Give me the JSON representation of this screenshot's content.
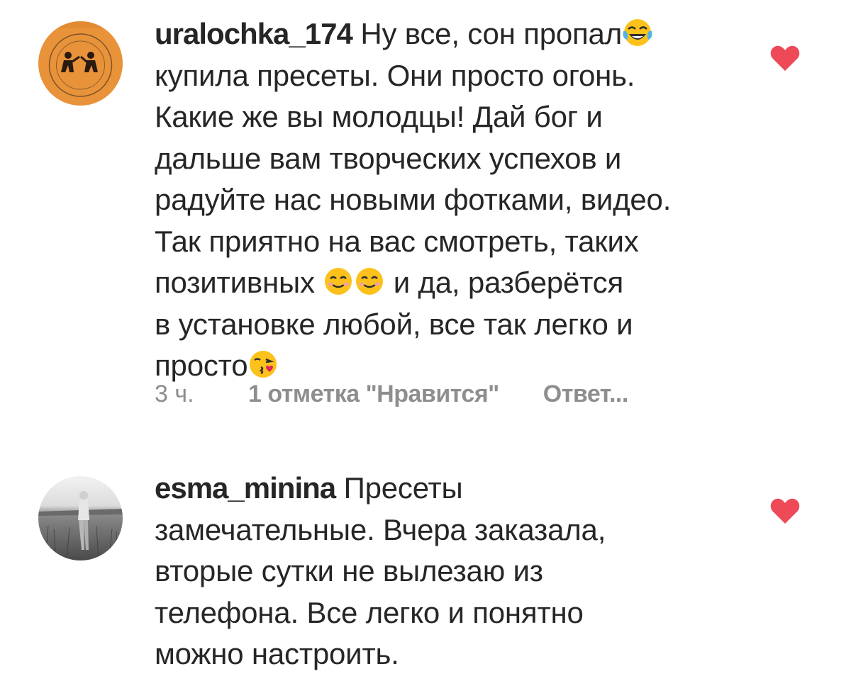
{
  "comments": [
    {
      "username": "uralochka_174",
      "text_line_1": " Ну все, сон пропал",
      "text_line_2": "купила пресеты. Они просто огонь.",
      "text_line_3": "Какие же вы молодцы! Дай бог и",
      "text_line_4": "дальше вам творческих успехов и",
      "text_line_5": "радуйте нас  новыми фотками, видео.",
      "text_line_6": "Так приятно на вас смотреть, таких",
      "text_line_7a": "позитивных ",
      "text_line_7b": " и да, разберётся",
      "text_line_8": "в установке любой, все так легко и",
      "text_line_9": "просто",
      "emojis": [
        "tears-of-joy-emoji",
        "smiling-face-emoji",
        "smiling-face-emoji",
        "kissing-heart-emoji"
      ],
      "time": "3 ч.",
      "likes": "1 отметка \"Нравится\"",
      "reply": "Ответ..."
    },
    {
      "username": "esma_minina",
      "text_line_1": " Пресеты",
      "text_line_2": "замечательные.  Вчера заказала,",
      "text_line_3": "вторые сутки не вылезаю из",
      "text_line_4": "телефона. Все легко и понятно",
      "text_line_5": "можно настроить."
    }
  ],
  "colors": {
    "heart": "#ed4956",
    "text": "#262626",
    "meta": "#8e8e8e"
  }
}
